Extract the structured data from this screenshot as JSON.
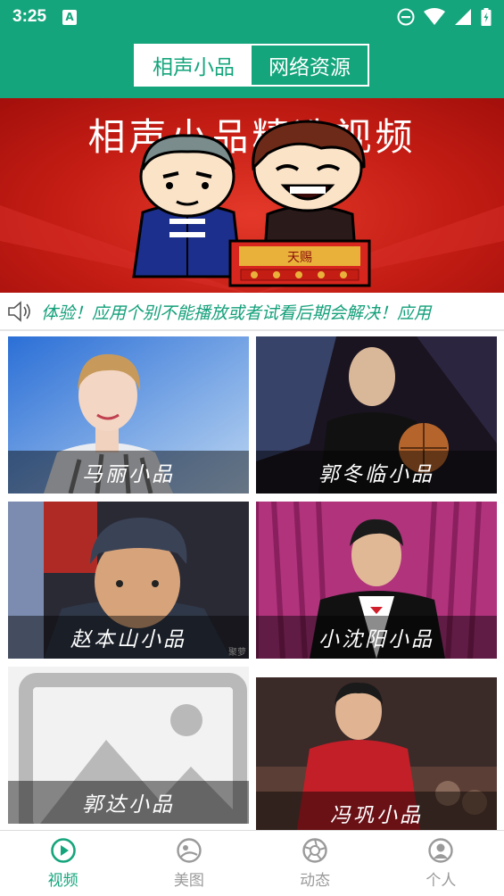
{
  "status_bar": {
    "time": "3:25",
    "a_icon": "A"
  },
  "header": {
    "tabs": [
      {
        "label": "相声小品"
      },
      {
        "label": "网络资源"
      }
    ],
    "active_tab": 0
  },
  "banner": {
    "title": "相声小品精选视频",
    "box_text": "天赐"
  },
  "notice": {
    "icon": "speaker-icon",
    "text": "体验！应用个别不能播放或者试看后期会解决！应用"
  },
  "videos": [
    {
      "label": "马丽小品"
    },
    {
      "label": "郭冬临小品"
    },
    {
      "label": "赵本山小品",
      "watermark": "聚萝"
    },
    {
      "label": "小沈阳小品"
    },
    {
      "label": "郭达小品"
    },
    {
      "label": "冯巩小品"
    }
  ],
  "bottom_nav": [
    {
      "label": "视频",
      "icon": "play-circle-icon"
    },
    {
      "label": "美图",
      "icon": "image-icon"
    },
    {
      "label": "动态",
      "icon": "aperture-icon"
    },
    {
      "label": "个人",
      "icon": "user-icon"
    }
  ],
  "colors": {
    "accent": "#15a57c",
    "banner_red": "#c41d14",
    "inactive": "#9a9a9a"
  }
}
